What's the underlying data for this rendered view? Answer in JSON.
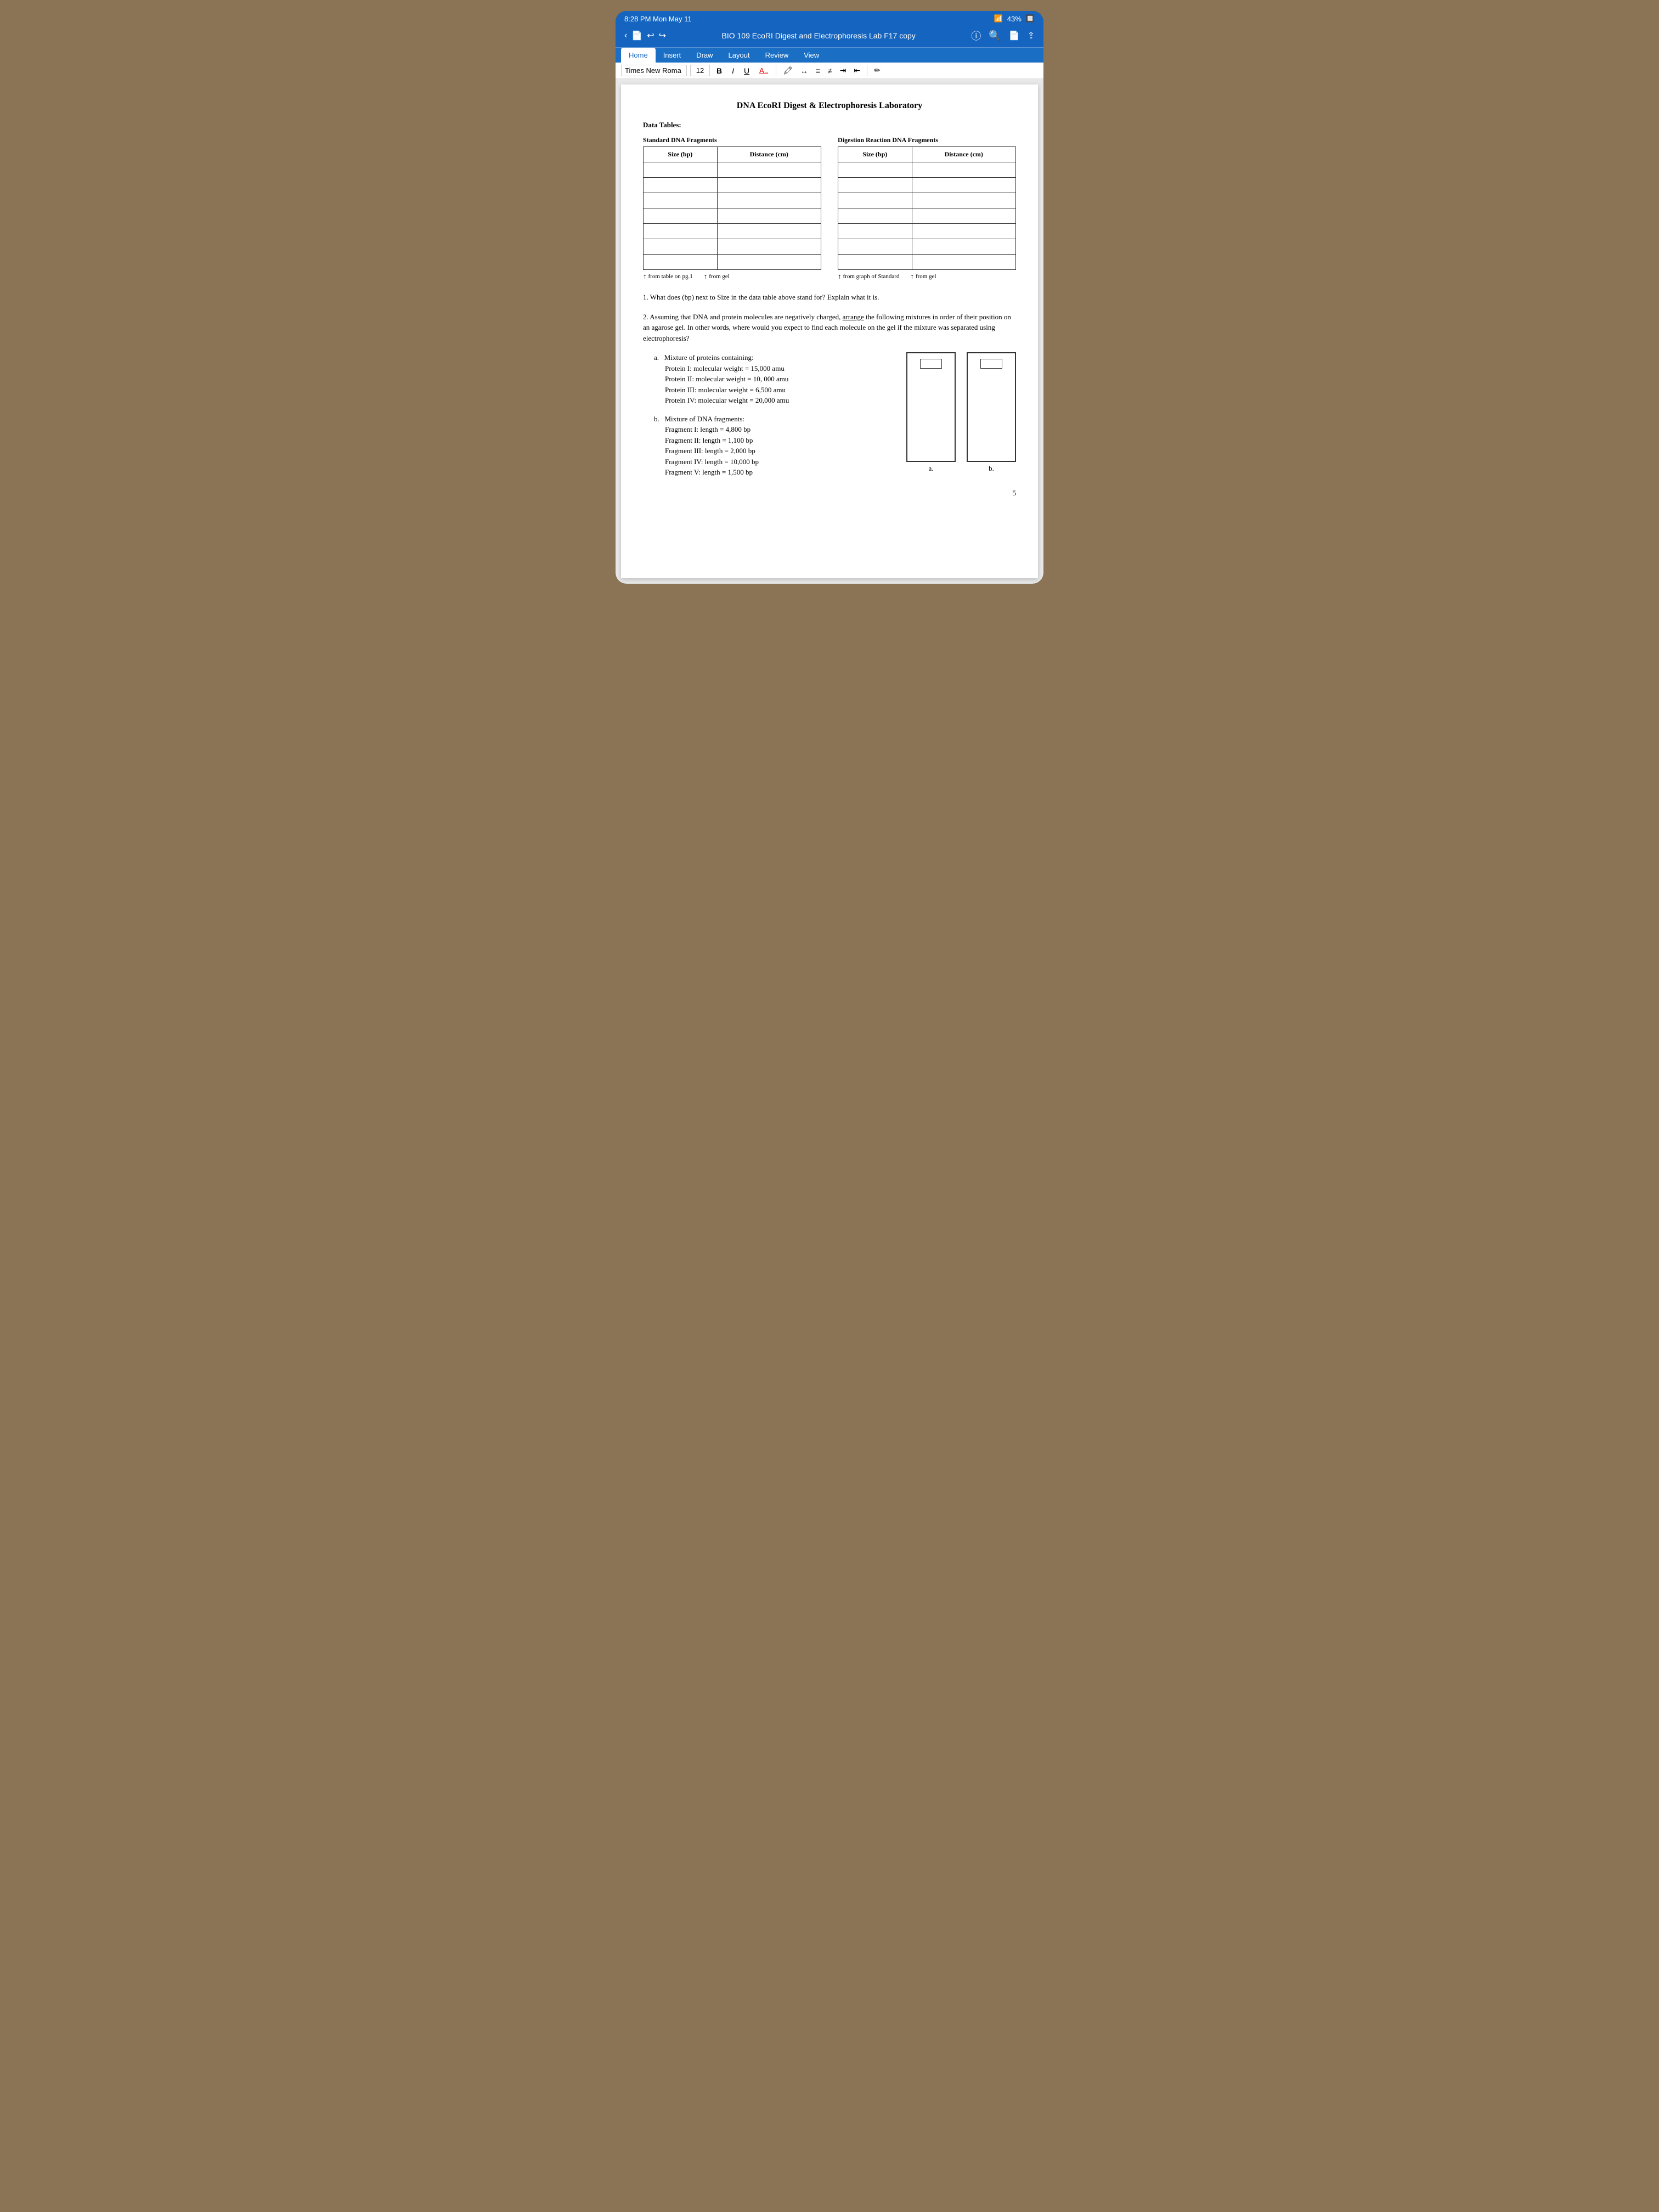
{
  "statusBar": {
    "time": "8:28 PM  Mon May 11",
    "battery": "43%",
    "wifi": "WiFi"
  },
  "titleBar": {
    "title": "BIO 109 EcoRI Digest and Electrophoresis Lab F17 copy",
    "navBack": "<",
    "navDoc": "🗎",
    "navUndo": "↩",
    "navRedo": "↪"
  },
  "ribbonTabs": [
    "Home",
    "Insert",
    "Draw",
    "Layout",
    "Review",
    "View"
  ],
  "activeTab": "Home",
  "formattingBar": {
    "fontName": "Times New Roma",
    "fontSize": "12",
    "bold": "B",
    "italic": "I",
    "underline": "U",
    "fontColor": "A.."
  },
  "document": {
    "title": "DNA EcoRI Digest & Electrophoresis Laboratory",
    "dataTables": {
      "label": "Data Tables:",
      "standardTable": {
        "title": "Standard DNA Fragments",
        "columns": [
          "Size (bp)",
          "Distance (cm)"
        ],
        "rows": 7
      },
      "digestionTable": {
        "title": "Digestion Reaction DNA Fragments",
        "columns": [
          "Size (bp)",
          "Distance (cm)"
        ],
        "rows": 7
      },
      "standardNotes": [
        "from table on pg.1",
        "from gel"
      ],
      "digestionNotes": [
        "from graph of Standard",
        "from gel"
      ]
    },
    "questions": {
      "q1": "1.  What does (bp) next to Size in the data table above stand for?  Explain what it is.",
      "q2prefix": "2.  Assuming that DNA and protein molecules are negatively charged,",
      "q2underline": "arrange",
      "q2suffix": "the following mixtures in order of their position on an agarose gel.  In other words, where would you expect to find each molecule on the gel if the mixture was separated using electrophoresis?",
      "q2a": {
        "label": "a.",
        "text": "Mixture of proteins containing:",
        "items": [
          "Protein I:  molecular weight = 15,000 amu",
          "Protein II:  molecular weight = 10, 000 amu",
          "Protein III:  molecular weight = 6,500 amu",
          "Protein IV:  molecular weight = 20,000 amu"
        ]
      },
      "q2b": {
        "label": "b.",
        "text": "Mixture of DNA fragments:",
        "items": [
          "Fragment I: length = 4,800 bp",
          "Fragment II: length = 1,100 bp",
          "Fragment III: length = 2,000 bp",
          "Fragment IV: length = 10,000 bp",
          "Fragment V: length = 1,500 bp"
        ]
      },
      "gelLabels": [
        "a.",
        "b."
      ]
    }
  },
  "pageNumber": "5"
}
